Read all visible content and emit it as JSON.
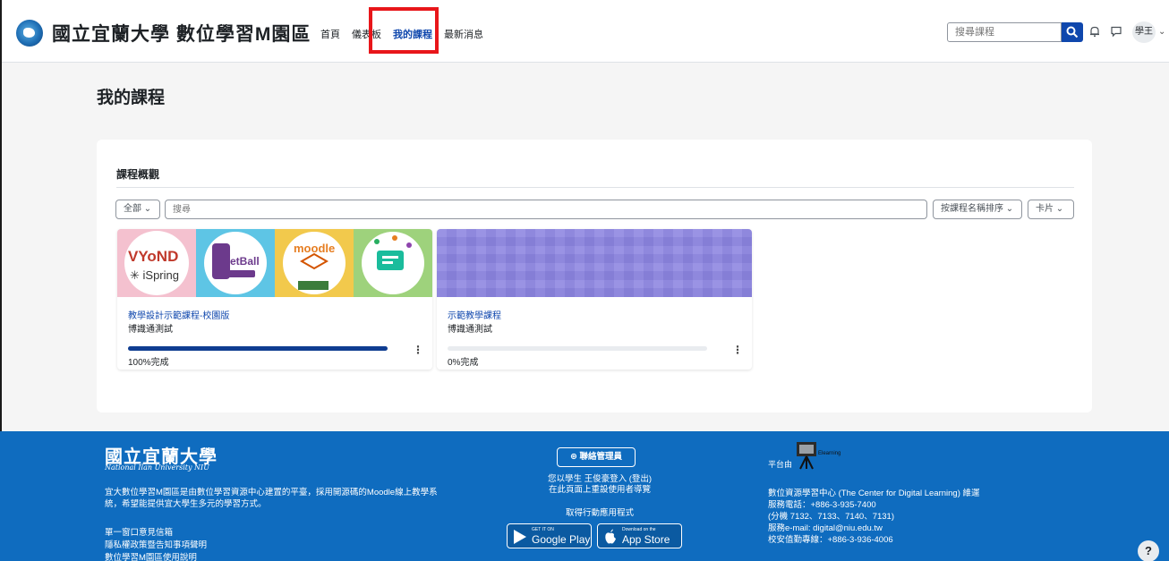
{
  "header": {
    "site_name": "國立宜蘭大學 數位學習M園區",
    "nav": [
      "首頁",
      "儀表板",
      "我的課程",
      "最新消息"
    ],
    "active_nav": "我的課程",
    "search_placeholder": "搜尋課程",
    "user_initials": "學王",
    "accent_color": "#0f47ad",
    "highlight_color": "#e8161a"
  },
  "main": {
    "page_title": "我的課程",
    "overview": {
      "title": "課程概觀",
      "filter_all": "全部",
      "search_placeholder": "搜尋",
      "sort_label": "按課程名稱排序",
      "view_label": "卡片"
    },
    "courses": [
      {
        "name": "教學設計示範課程-校園版",
        "category": "博識通測試",
        "progress_percent": 100,
        "progress_text": "100%完成"
      },
      {
        "name": "示範教學課程",
        "category": "博識通測試",
        "progress_percent": 0,
        "progress_text": "0%完成"
      }
    ]
  },
  "footer": {
    "logo_cn": "國立宜蘭大學",
    "logo_en": "National Ilan University NIU",
    "description": "宜大數位學習M園區是由數位學習資源中心建置的平臺，採用開源碼的Moodle線上教學系統，希望能提供宜大學生多元的學習方式。",
    "links": [
      "單一窗口意見信箱",
      "隱私權政策暨告知事項聲明",
      "數位學習M園區使用說明"
    ],
    "contact_label": "聯絡管理員",
    "login_status": "您以學生 王俊豪登入 (登出)",
    "reset_tour": "在此頁面上重設使用者導覽",
    "app_title": "取得行動應用程式",
    "google_play_small": "GET IT ON",
    "google_play": "Google Play",
    "app_store_small": "Download on the",
    "app_store": "App Store",
    "platform_by": "平台由",
    "center": "數位資源學習中心 (The Center for Digital Learning) 維運",
    "phone": "服務電話：+886-3-935-7400",
    "ext": "(分機 7132、7133、7140、7131)",
    "email": "服務e-mail: digital@niu.edu.tw",
    "security": "校安值勤專線：+886-3-936-4006",
    "elearning": "Elearning"
  }
}
